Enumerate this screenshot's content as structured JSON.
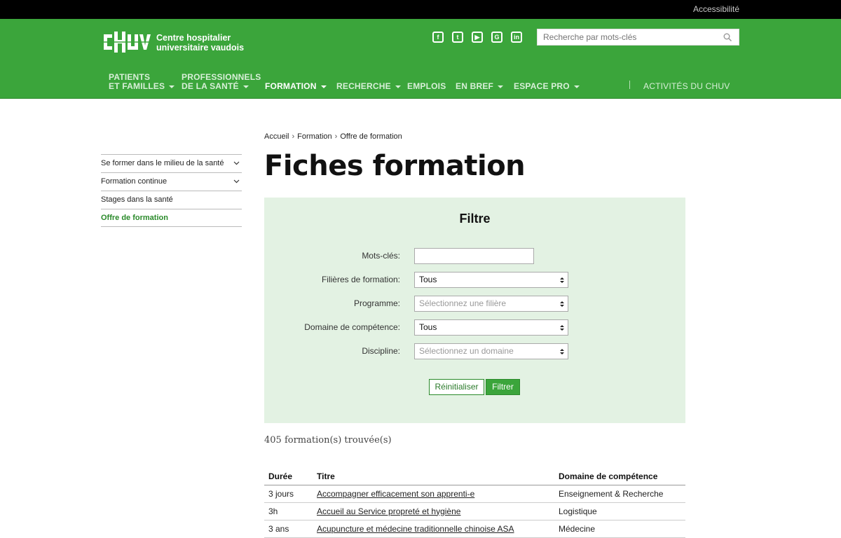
{
  "topbar": {
    "accessibility": "Accessibilité"
  },
  "header": {
    "logo_alt": "CHUV",
    "org_line1": "Centre hospitalier",
    "org_line2": "universitaire vaudois",
    "social": [
      "facebook-icon",
      "twitter-icon",
      "youtube-icon",
      "googleplus-icon",
      "linkedin-icon"
    ],
    "search": {
      "placeholder": "Recherche par mots-clés"
    },
    "nav": [
      {
        "line1": "PATIENTS",
        "line2": "ET FAMILLES"
      },
      {
        "line1": "PROFESSIONNELS",
        "line2": "DE LA SANTÉ"
      },
      {
        "label": "FORMATION"
      },
      {
        "label": "RECHERCHE"
      },
      {
        "label": "EMPLOIS"
      },
      {
        "label": "EN BREF"
      },
      {
        "label": "ESPACE PRO"
      },
      {
        "label": "ACTIVITÉS DU CHUV"
      }
    ]
  },
  "sidebar": {
    "items": [
      {
        "label": "Se former dans le milieu de la santé"
      },
      {
        "label": "Formation continue"
      },
      {
        "label": "Stages dans la santé"
      },
      {
        "label": "Offre de formation"
      }
    ]
  },
  "breadcrumb": {
    "items": [
      "Accueil",
      "Formation",
      "Offre de formation"
    ],
    "separator": "›"
  },
  "page_title": "Fiches formation",
  "filter": {
    "heading": "Filtre",
    "keywords_label": "Mots-clés:",
    "keywords_value": "",
    "filiere_label": "Filières de formation:",
    "filiere_value": "Tous",
    "programme_label": "Programme:",
    "programme_value": "Sélectionnez une filière",
    "domaine_label": "Domaine de compétence:",
    "domaine_value": "Tous",
    "discipline_label": "Discipline:",
    "discipline_value": "Sélectionnez un domaine",
    "reset_label": "Réinitialiser",
    "submit_label": "Filtrer"
  },
  "results": {
    "count_text": "405 formation(s) trouvée(s)",
    "headers": [
      "Durée",
      "Titre",
      "Domaine de compétence"
    ],
    "rows": [
      {
        "duree": "3 jours",
        "titre": "Accompagner efficacement son apprenti-e",
        "domaine": "Enseignement & Recherche"
      },
      {
        "duree": "3h",
        "titre": "Accueil au Service propreté et hygiène",
        "domaine": "Logistique"
      },
      {
        "duree": "3 ans",
        "titre": "Acupuncture et médecine traditionnelle chinoise ASA",
        "domaine": "Médecine"
      }
    ]
  },
  "colors": {
    "brand_green": "#3ba53b",
    "active_green": "#2a8a2a",
    "filter_bg": "#e3f2e3"
  }
}
